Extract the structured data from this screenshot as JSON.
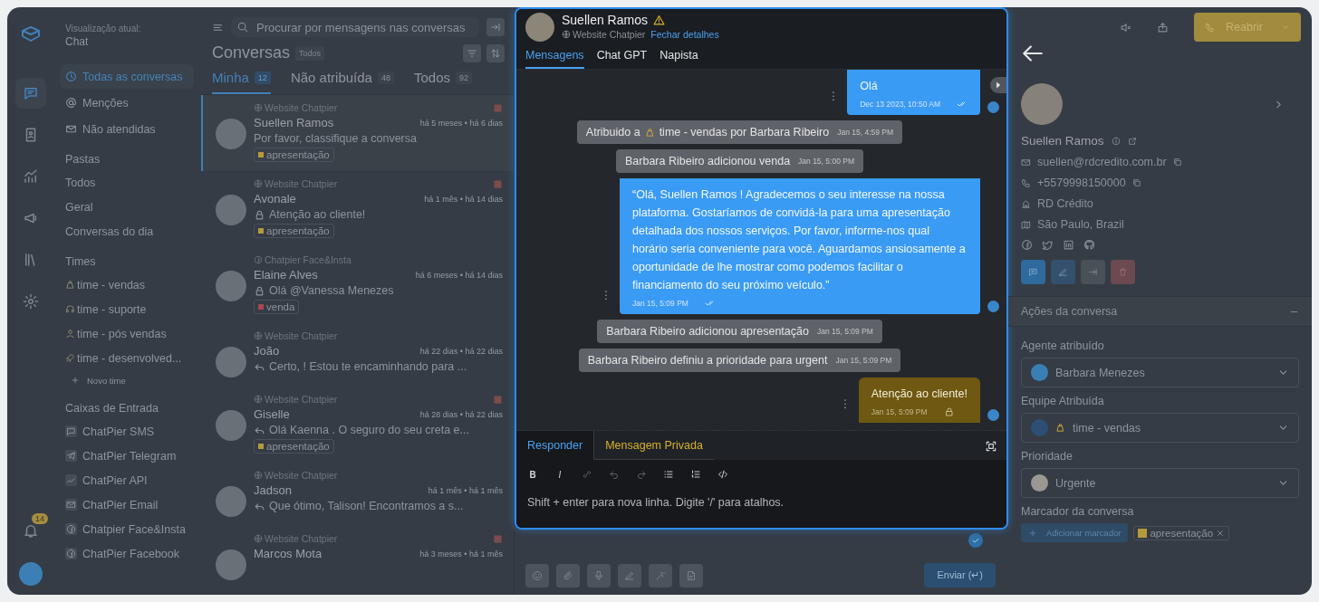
{
  "rail": {
    "items": [
      {
        "selected": true
      },
      {
        "selected": false
      },
      {
        "selected": false
      },
      {
        "selected": false
      },
      {
        "selected": false
      },
      {
        "selected": false
      }
    ],
    "notification_count": "14"
  },
  "sidebar": {
    "view_label": "Visualização atual:",
    "view_name": "Chat",
    "nav": [
      {
        "label": "Todas as conversas",
        "selected": true
      },
      {
        "label": "Menções",
        "selected": false
      },
      {
        "label": "Não atendidas",
        "selected": false
      }
    ],
    "folders_title": "Pastas",
    "folders": [
      "Todos",
      "Geral",
      "Conversas do dia"
    ],
    "teams_title": "Times",
    "teams": [
      "time - vendas",
      "time - suporte",
      "time - pós vendas",
      "time - desenvolved..."
    ],
    "new_team": "Novo time",
    "inboxes_title": "Caixas de Entrada",
    "inboxes": [
      "ChatPier SMS",
      "ChatPier Telegram",
      "ChatPier API",
      "ChatPier Email",
      "Chatpier Face&Insta",
      "ChatPier Facebook"
    ]
  },
  "conversations": {
    "search_placeholder": "Procurar por mensagens nas conversas",
    "title": "Conversas",
    "filter_badge": "Todos",
    "tabs": [
      {
        "label": "Minha",
        "count": "12",
        "selected": true
      },
      {
        "label": "Não atribuída",
        "count": "48",
        "selected": false
      },
      {
        "label": "Todos",
        "count": "92",
        "selected": false
      }
    ],
    "items": [
      {
        "inbox": {
          "name": "Website Chatpier",
          "kind": "website"
        },
        "name": "Suellen Ramos",
        "time": "há 5 meses • há 6 dias",
        "preview": {
          "text": "Por favor, classifique a conversa",
          "kind": "plain"
        },
        "label": {
          "text": "apresentação",
          "color": "#b59a3c"
        },
        "urgent": true,
        "selected": true
      },
      {
        "inbox": {
          "name": "Website Chatpier",
          "kind": "website"
        },
        "name": "Avonale",
        "time": "há 1 mês • há 14 dias",
        "preview": {
          "text": "Atenção ao cliente!",
          "kind": "private"
        },
        "label": {
          "text": "apresentação",
          "color": "#b59a3c"
        },
        "urgent": true,
        "selected": false
      },
      {
        "inbox": {
          "name": "Chatpier Face&Insta",
          "kind": "facebook"
        },
        "name": "Elaine Alves",
        "time": "há 6 meses • há 14 dias",
        "preview": {
          "text": "Olá @Vanessa Menezes",
          "kind": "private"
        },
        "label": {
          "text": "venda",
          "color": "#a8474f"
        },
        "urgent": false,
        "selected": false
      },
      {
        "inbox": {
          "name": "Website Chatpier",
          "kind": "website"
        },
        "name": "João",
        "time": "há 22 dias • há 22 dias",
        "preview": {
          "text": "Certo, ! Estou te encaminhando para ...",
          "kind": "reply"
        },
        "urgent": false,
        "selected": false
      },
      {
        "inbox": {
          "name": "Website Chatpier",
          "kind": "website"
        },
        "name": "Giselle",
        "time": "há 28 dias • há 22 dias",
        "preview": {
          "text": "Olá Kaenna . O seguro do seu creta e...",
          "kind": "reply"
        },
        "label": {
          "text": "apresentação",
          "color": "#b59a3c"
        },
        "urgent": true,
        "selected": false
      },
      {
        "inbox": {
          "name": "Website Chatpier",
          "kind": "website"
        },
        "name": "Jadson",
        "time": "há 1 mês • há 1 mês",
        "preview": {
          "text": "Que ótimo, Talison! Encontramos a s...",
          "kind": "reply"
        },
        "urgent": false,
        "selected": false
      },
      {
        "inbox": {
          "name": "Website Chatpier",
          "kind": "website"
        },
        "name": "Marcos Mota",
        "time": "há 3 meses • há 1 mês",
        "urgent": true,
        "selected": false
      }
    ]
  },
  "chat": {
    "name": "Suellen Ramos",
    "inbox": "Website Chatpier",
    "close_link": "Fechar detalhes",
    "tabs": [
      {
        "label": "Mensagens",
        "selected": true
      },
      {
        "label": "Chat GPT",
        "selected": false
      },
      {
        "label": "Napista",
        "selected": false
      }
    ],
    "messages": [
      {
        "kind": "outgoing",
        "text": "Olá",
        "time": "Dec 13 2023, 10:50 AM"
      },
      {
        "kind": "activity",
        "text": "Atribuido a",
        "text_after": "time - vendas por Barbara Ribeiro",
        "time": "Jan 15, 4:59 PM"
      },
      {
        "kind": "activity",
        "text": "Barbara Ribeiro adicionou venda",
        "time": "Jan 15, 5:00 PM"
      },
      {
        "kind": "outgoing",
        "text": "“Olá, Suellen Ramos ! Agradecemos o seu interesse na nossa plataforma. Gostaríamos de convidá-la para uma apresentação detalhada dos nossos serviços. Por favor, informe-nos qual horário seria conveniente para você. Aguardamos ansiosamente a oportunidade de lhe mostrar como podemos facilitar o financiamento do seu próximo veículo.”",
        "time": "Jan 15, 5:09 PM"
      },
      {
        "kind": "activity",
        "text": "Barbara Ribeiro adicionou apresentação",
        "time": "Jan 15, 5:09 PM"
      },
      {
        "kind": "activity",
        "text": "Barbara Ribeiro definiu a prioridade para urgent",
        "time": "Jan 15, 5:09 PM"
      },
      {
        "kind": "private",
        "text": "Atenção ao cliente!",
        "time": "Jan 15, 5:09 PM"
      }
    ],
    "composer_tabs": [
      {
        "label": "Responder",
        "kind": "reply",
        "selected": true
      },
      {
        "label": "Mensagem Privada",
        "kind": "private",
        "selected": false
      }
    ],
    "toolbar_bold": "B",
    "toolbar_italic": "I",
    "placeholder": "Shift + enter para nova linha. Digite '/' para atalhos.",
    "send_button": "Enviar (↵)"
  },
  "contact": {
    "reopen_button": "Reabrir",
    "name": "Suellen Ramos",
    "email": "suellen@rdcredito.com.br",
    "phone": "+5579998150000",
    "company": "RD Crédito",
    "location": "São Paulo, Brazil",
    "actions_title": "Ações da conversa",
    "agent_label": "Agente atribuído",
    "agent": "Barbara Menezes",
    "team_label": "Equipe Atribuída",
    "team": "time - vendas",
    "priority_label": "Prioridade",
    "priority": "Urgente",
    "labels_title": "Marcador da conversa",
    "add_label_button": "Adicionar marcador",
    "labels": [
      {
        "text": "apresentação",
        "color": "#b59a3c"
      }
    ]
  }
}
